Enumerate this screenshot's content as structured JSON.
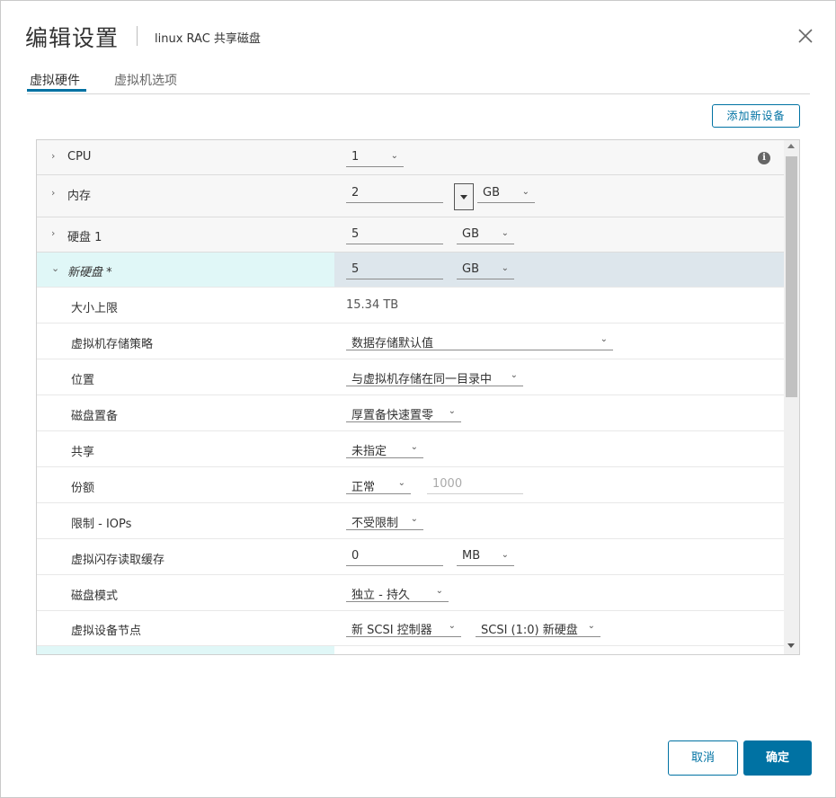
{
  "dialog": {
    "title": "编辑设置",
    "subtitle": "linux RAC 共享磁盘",
    "close_icon": "close-icon"
  },
  "tabs": [
    {
      "label": "虚拟硬件",
      "active": true
    },
    {
      "label": "虚拟机选项",
      "active": false
    }
  ],
  "add_device_label": "添加新设备",
  "rows": {
    "cpu": {
      "label": "CPU",
      "value": "1"
    },
    "memory": {
      "label": "内存",
      "value": "2",
      "unit": "GB"
    },
    "disk1": {
      "label": "硬盘 1",
      "value": "5",
      "unit": "GB"
    },
    "new_disk": {
      "label": "新硬盘 *",
      "value": "5",
      "unit": "GB"
    },
    "max_size": {
      "label": "大小上限",
      "value": "15.34 TB"
    },
    "storage_policy": {
      "label": "虚拟机存储策略",
      "value": "数据存储默认值"
    },
    "location": {
      "label": "位置",
      "value": "与虚拟机存储在同一目录中"
    },
    "provisioning": {
      "label": "磁盘置备",
      "value": "厚置备快速置零"
    },
    "sharing": {
      "label": "共享",
      "value": "未指定"
    },
    "shares": {
      "label": "份额",
      "value": "正常",
      "number": "1000"
    },
    "limit_iops": {
      "label": "限制 - IOPs",
      "value": "不受限制"
    },
    "flash_cache": {
      "label": "虚拟闪存读取缓存",
      "value": "0",
      "unit": "MB"
    },
    "disk_mode": {
      "label": "磁盘模式",
      "value": "独立 - 持久"
    },
    "device_node": {
      "label": "虚拟设备节点",
      "controller": "新 SCSI 控制器",
      "node": "SCSI (1:0) 新硬盘"
    }
  },
  "footer": {
    "cancel": "取消",
    "ok": "确定"
  },
  "colors": {
    "accent": "#0072a3",
    "selected_row": "#dde6ec",
    "selected_row_left": "#e0f7f7"
  }
}
